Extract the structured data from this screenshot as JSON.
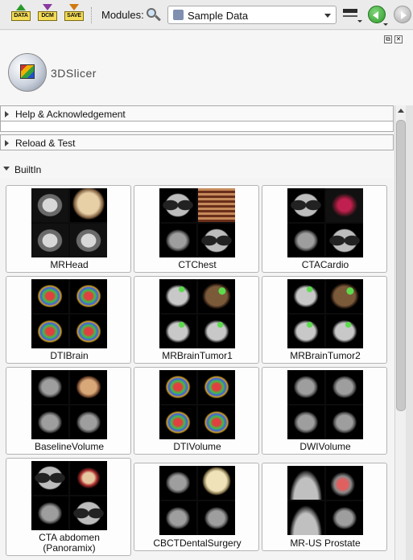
{
  "toolbar": {
    "load_data_label": "DATA",
    "dicom_label": "DCM",
    "save_label": "SAVE",
    "modules_label": "Modules:",
    "module_selected": "Sample Data"
  },
  "app": {
    "logo_text": "3DSlicer"
  },
  "sections": {
    "help": "Help & Acknowledgement",
    "reload": "Reload & Test",
    "builtin": "BuiltIn"
  },
  "datasets": [
    {
      "label": "MRHead",
      "icon": "mr-head-thumbnail"
    },
    {
      "label": "CTChest",
      "icon": "ct-chest-thumbnail"
    },
    {
      "label": "CTACardio",
      "icon": "cta-cardio-thumbnail"
    },
    {
      "label": "DTIBrain",
      "icon": "dti-brain-thumbnail"
    },
    {
      "label": "MRBrainTumor1",
      "icon": "mr-brain-tumor1-thumbnail"
    },
    {
      "label": "MRBrainTumor2",
      "icon": "mr-brain-tumor2-thumbnail"
    },
    {
      "label": "BaselineVolume",
      "icon": "baseline-volume-thumbnail"
    },
    {
      "label": "DTIVolume",
      "icon": "dti-volume-thumbnail"
    },
    {
      "label": "DWIVolume",
      "icon": "dwi-volume-thumbnail"
    },
    {
      "label": "CTA abdomen",
      "label2": "(Panoramix)",
      "icon": "cta-abdomen-thumbnail"
    },
    {
      "label": "CBCTDentalSurgery",
      "icon": "cbct-dental-thumbnail"
    },
    {
      "label": "MR-US Prostate",
      "icon": "mr-us-prostate-thumbnail"
    }
  ]
}
